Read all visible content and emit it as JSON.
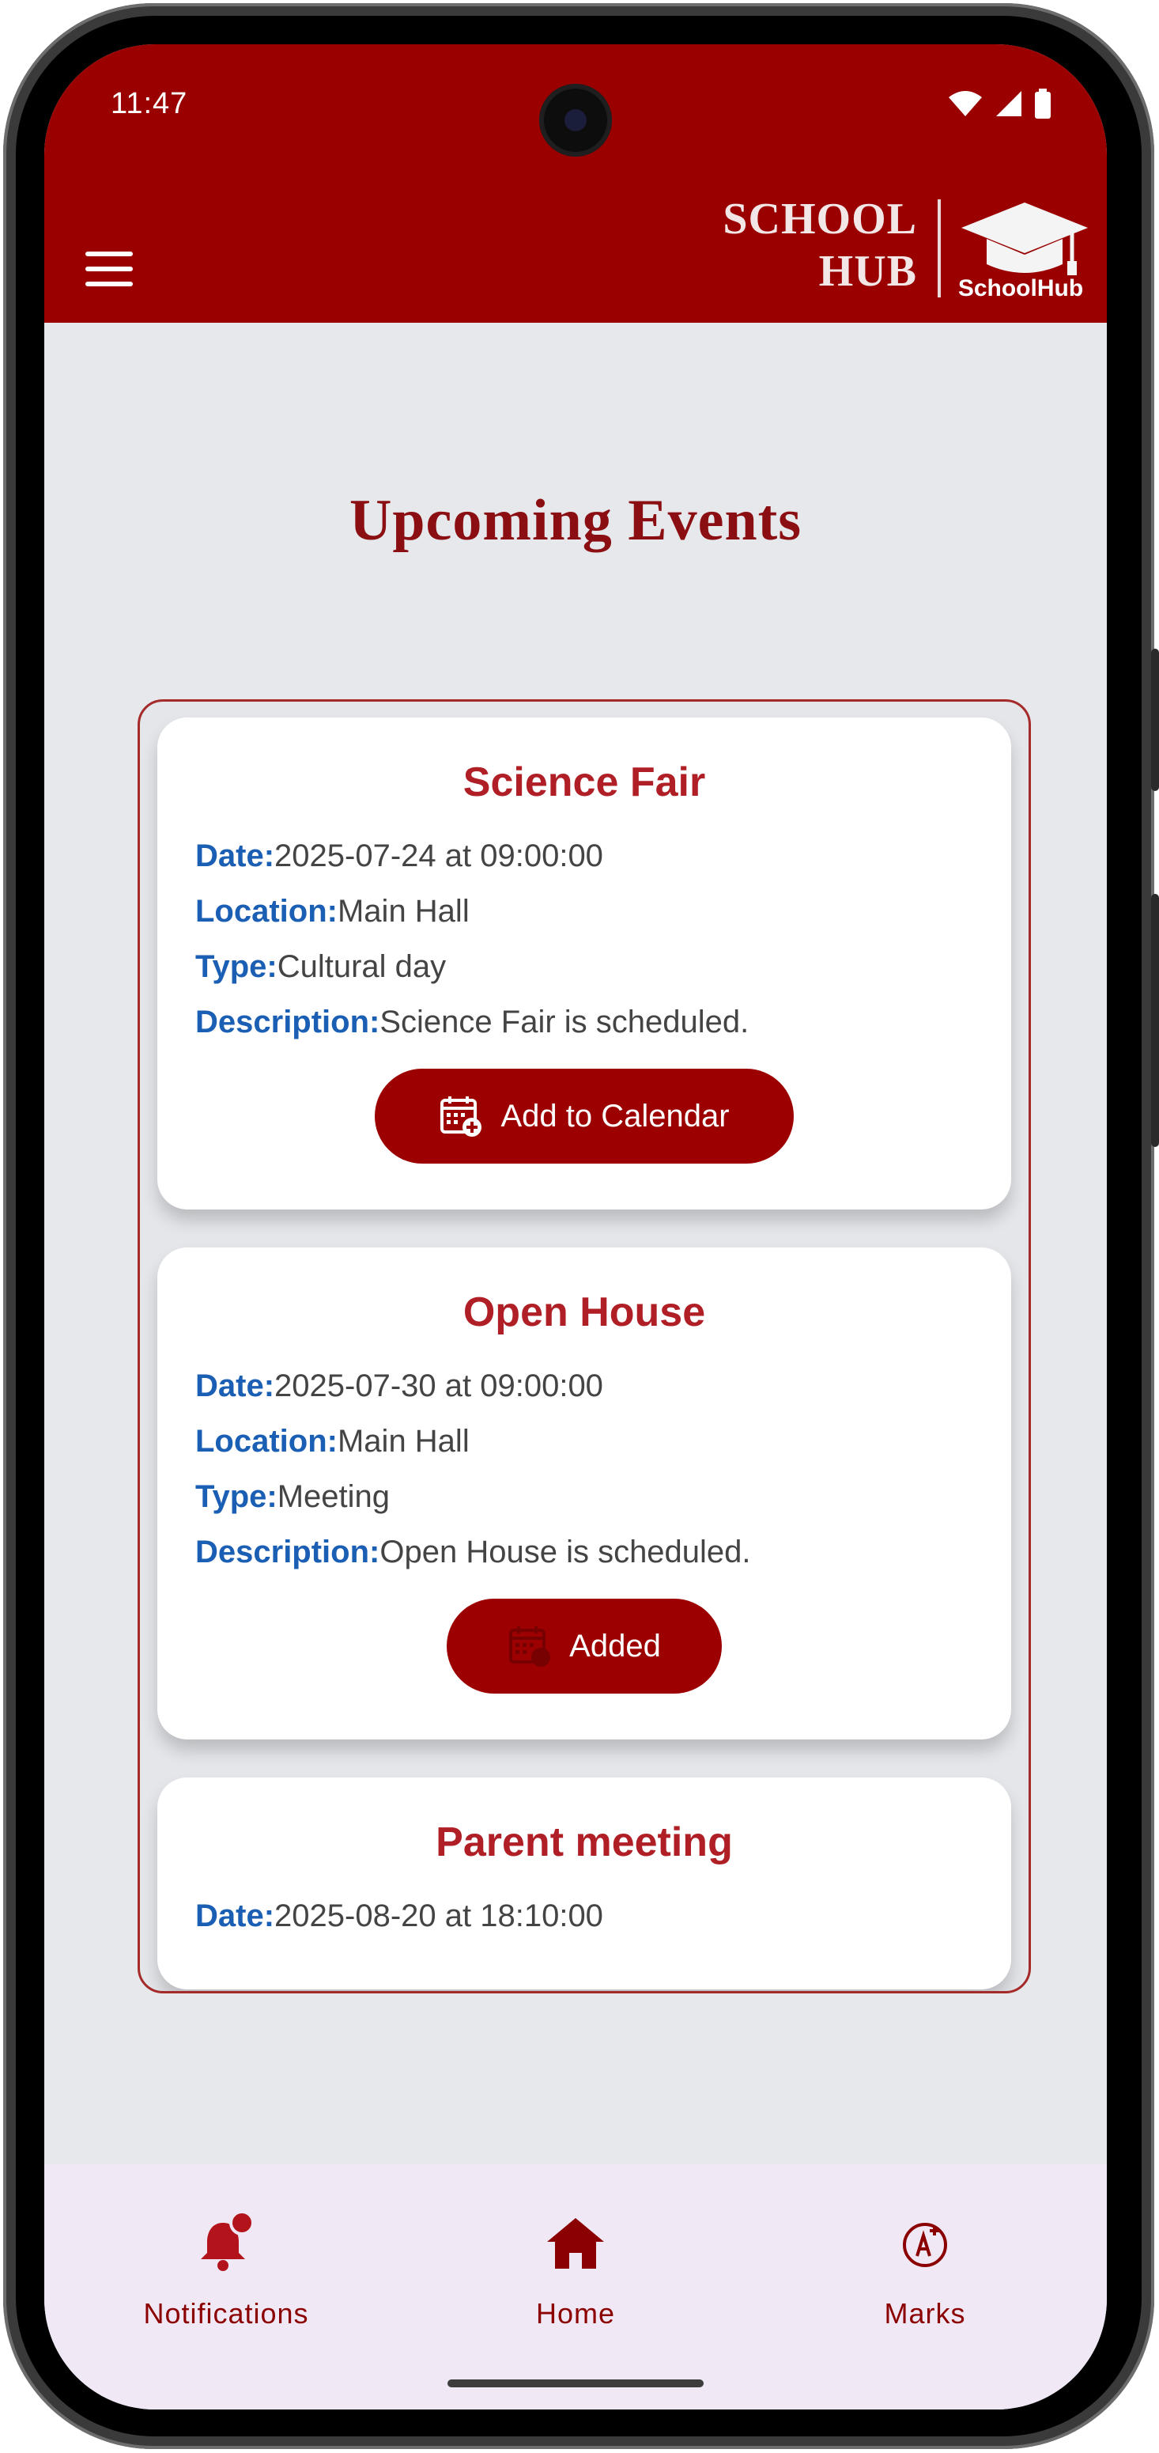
{
  "status_bar": {
    "time": "11:47"
  },
  "header": {
    "brand_line1": "SCHOOL",
    "brand_line2": "HUB",
    "logo_label": "SchoolHub",
    "accent_color": "#9a0000"
  },
  "page": {
    "title": "Upcoming Events"
  },
  "labels": {
    "date": "Date:",
    "location": "Location:",
    "type": "Type:",
    "description": "Description:"
  },
  "events": [
    {
      "title": "Science Fair",
      "date": "2025-07-24 at 09:00:00",
      "location": "Main Hall",
      "type": "Cultural day",
      "description": "Science Fair is scheduled.",
      "button_label": "Add to Calendar",
      "button_icon": "calendar-add-icon"
    },
    {
      "title": "Open House",
      "date": "2025-07-30 at 09:00:00",
      "location": "Main Hall",
      "type": "Meeting",
      "description": "Open House is scheduled.",
      "button_label": "Added",
      "button_icon": "calendar-added-icon"
    },
    {
      "title": "Parent meeting",
      "date": "2025-08-20 at 18:10:00"
    }
  ],
  "bottom_nav": [
    {
      "label": "Notifications",
      "icon": "bell-notification-icon"
    },
    {
      "label": "Home",
      "icon": "home-icon"
    },
    {
      "label": "Marks",
      "icon": "grade-a-plus-icon"
    }
  ]
}
